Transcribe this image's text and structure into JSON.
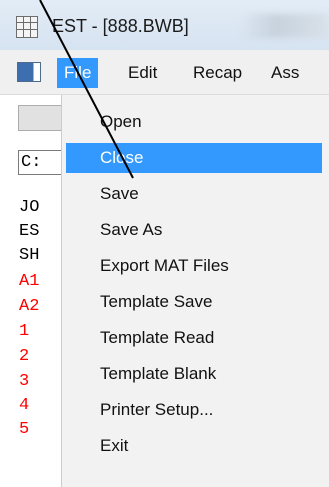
{
  "window": {
    "title": "EST - [888.BWB]",
    "icon": "spreadsheet-grid-icon"
  },
  "menubar": {
    "app_icon": "window-system-menu-icon",
    "items": [
      {
        "label": "File",
        "active": true
      },
      {
        "label": "Edit",
        "active": false
      },
      {
        "label": "Recap",
        "active": false
      },
      {
        "label": "Ass",
        "active": false
      }
    ]
  },
  "left_pane": {
    "field_text": "C:",
    "lines": [
      {
        "text": "JO",
        "color": "#000000"
      },
      {
        "text": "ES",
        "color": "#000000"
      },
      {
        "text": "SH",
        "color": "#000000"
      },
      {
        "text": "A1",
        "color": "#ff0000"
      },
      {
        "text": "A2",
        "color": "#ff0000"
      },
      {
        "text": "1",
        "color": "#ff0000"
      },
      {
        "text": "2",
        "color": "#ff0000"
      },
      {
        "text": "3",
        "color": "#ff0000"
      },
      {
        "text": "4",
        "color": "#ff0000"
      },
      {
        "text": "5",
        "color": "#ff0000"
      }
    ]
  },
  "file_menu": {
    "items": [
      {
        "label": "Open",
        "highlighted": false
      },
      {
        "label": "Close",
        "highlighted": true
      },
      {
        "label": "Save",
        "highlighted": false
      },
      {
        "label": "Save As",
        "highlighted": false
      },
      {
        "label": "Export MAT Files",
        "highlighted": false
      },
      {
        "label": "Template Save",
        "highlighted": false
      },
      {
        "label": "Template Read",
        "highlighted": false
      },
      {
        "label": "Template Blank",
        "highlighted": false
      },
      {
        "label": "Printer Setup...",
        "highlighted": false
      },
      {
        "label": "Exit",
        "highlighted": false
      }
    ]
  },
  "colors": {
    "highlight": "#3399ff",
    "menu_background": "#f2f2f2",
    "red_text": "#ff0000"
  }
}
